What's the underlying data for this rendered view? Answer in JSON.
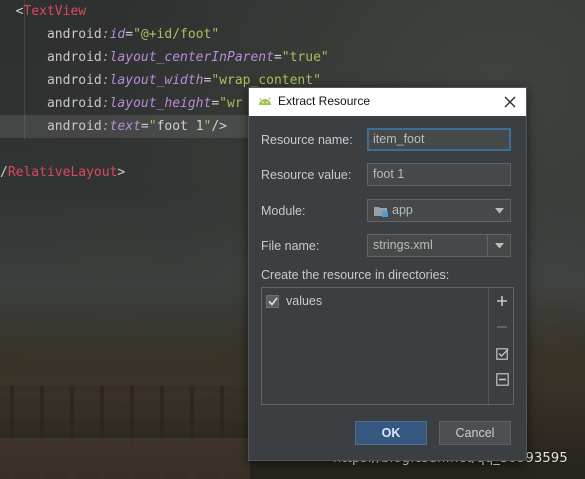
{
  "editor": {
    "lines": [
      {
        "parts": [
          {
            "c": "punct",
            "t": "<"
          },
          {
            "c": "tag-red",
            "t": "TextView"
          }
        ],
        "indent": "  "
      },
      {
        "parts": [
          {
            "c": "attr-ns",
            "t": "android"
          },
          {
            "c": "attr-name",
            "t": ":id"
          },
          {
            "c": "punct",
            "t": "="
          },
          {
            "c": "val",
            "t": "\"@+id/foot\""
          }
        ],
        "indent": "      "
      },
      {
        "parts": [
          {
            "c": "attr-ns",
            "t": "android"
          },
          {
            "c": "attr-name",
            "t": ":layout_centerInParent"
          },
          {
            "c": "punct",
            "t": "="
          },
          {
            "c": "val",
            "t": "\"true\""
          }
        ],
        "indent": "      "
      },
      {
        "parts": [
          {
            "c": "attr-ns",
            "t": "android"
          },
          {
            "c": "attr-name",
            "t": ":layout_width"
          },
          {
            "c": "punct",
            "t": "="
          },
          {
            "c": "val",
            "t": "\"wrap_content\""
          }
        ],
        "indent": "      "
      },
      {
        "parts": [
          {
            "c": "attr-ns",
            "t": "android"
          },
          {
            "c": "attr-name",
            "t": ":layout_height"
          },
          {
            "c": "punct",
            "t": "="
          },
          {
            "c": "val",
            "t": "\"wr"
          }
        ],
        "indent": "      "
      },
      {
        "parts": [
          {
            "c": "attr-ns",
            "t": "android"
          },
          {
            "c": "attr-name",
            "t": ":text"
          },
          {
            "c": "punct",
            "t": "="
          },
          {
            "c": "val",
            "t": "\""
          },
          {
            "c": "attr",
            "t": "foot 1"
          },
          {
            "c": "val",
            "t": "\""
          },
          {
            "c": "punct",
            "t": "/>"
          }
        ],
        "indent": "      ",
        "highlight": true
      },
      {
        "parts": [],
        "indent": ""
      },
      {
        "parts": [
          {
            "c": "punct",
            "t": "/"
          },
          {
            "c": "tag-red",
            "t": "RelativeLayout"
          },
          {
            "c": "punct",
            "t": ">"
          }
        ],
        "indent": ""
      }
    ]
  },
  "dialog": {
    "title": "Extract Resource",
    "resource_name_label": "Resource name:",
    "resource_name_value": "item_foot",
    "resource_value_label": "Resource value:",
    "resource_value_value": "foot 1",
    "module_label": "Module:",
    "module_value": "app",
    "file_name_label": "File name:",
    "file_name_value": "strings.xml",
    "dirs_label": "Create the resource in directories:",
    "dirs": [
      {
        "label": "values",
        "checked": true
      }
    ],
    "ok_label": "OK",
    "cancel_label": "Cancel"
  },
  "watermark": "https://blog.csdn.net/qq_30993595",
  "colors": {
    "accent": "#365880",
    "android_green": "#9fc54a",
    "focus_border": "#3d6e98"
  }
}
